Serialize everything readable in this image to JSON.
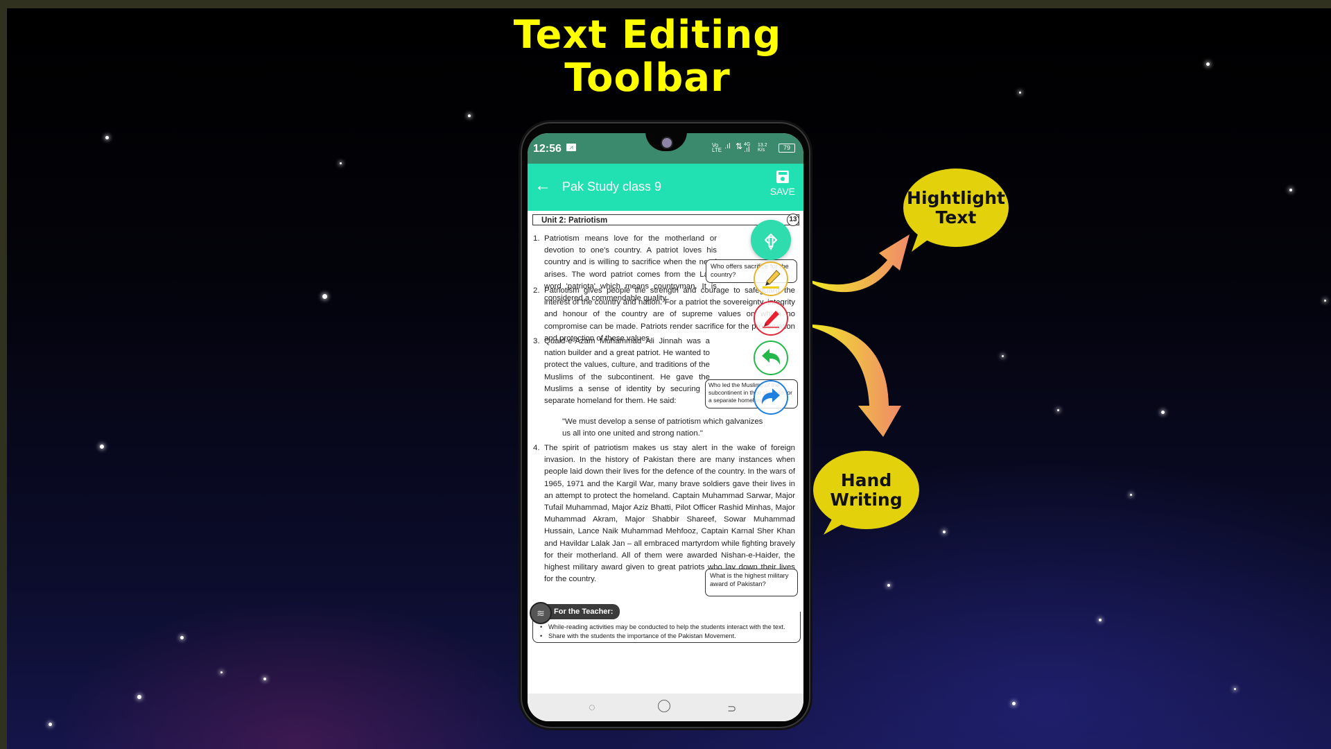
{
  "headline": {
    "line1": "Text Editing",
    "line2": "Toolbar"
  },
  "status_bar": {
    "time": "12:56",
    "activity_icon": "activity-icon",
    "volte": "Vo LTE",
    "network": "4G",
    "speed": "13.2",
    "speed_unit": "K/s",
    "battery": "79"
  },
  "app_bar": {
    "back_icon": "arrow-left-icon",
    "title": "Pak Study class 9",
    "save_label": "SAVE",
    "save_icon": "floppy-disk-icon"
  },
  "document": {
    "unit_title": "Unit 2:  Patriotism",
    "page_number": "13",
    "paragraphs": [
      {
        "num": "1.",
        "text": "Patriotism means love for the motherland or devotion to one's country. A patriot loves his country and is willing to sacrifice when the need arises. The word patriot comes from the Latin word 'patriota' which means countryman. It is considered a commendable quality."
      },
      {
        "num": "2.",
        "text": "Patriotism gives people the strength and courage to safeguard the interest of the country and nation. For a patriot the sovereignty, integrity and honour of the country are of supreme values on which no compromise can be made. Patriots render sacrifice for the preservation and protection of these values."
      },
      {
        "num": "3.",
        "text": "Quaid-e-Azam Muhammad Ali Jinnah was a nation builder and a great patriot. He wanted to protect the values, culture, and traditions of the Muslims of the subcontinent. He gave the Muslims a sense of identity by securing a separate homeland for them. He said:"
      },
      {
        "num": "4.",
        "text": "The spirit of patriotism makes us stay alert in the wake of foreign invasion. In the history of Pakistan there are many instances when people laid down their lives for the defence of the country. In the wars of 1965, 1971 and the Kargil War, many brave soldiers gave their lives in an attempt to protect the homeland. Captain Muhammad Sarwar, Major Tufail Muhammad, Major Aziz Bhatti, Pilot Officer Rashid Minhas, Major Muhammad Akram, Major Shabbir Shareef, Sowar Muhammad Hussain, Lance Naik Muhammad Mehfooz, Captain Karnal Sher Khan and Havildar Lalak Jan – all embraced martyrdom while fighting bravely for their motherland. All of them were awarded Nishan-e-Haider, the highest military award given to great patriots who lay down their lives for the country."
      }
    ],
    "quote": "\"We must develop a sense of patriotism which galvanizes us all into one united and strong nation.\"",
    "question_boxes": [
      "Who offers sacrifice for the country?",
      "Who led the Muslims of the subcontinent in their struggle for a separate homeland?",
      "What is the highest military award of Pakistan?"
    ],
    "teacher_title": "For the Teacher:",
    "teacher_notes": [
      "While-reading activities may be conducted to help the students interact with the text.",
      "Share with the students the importance of the Pakistan Movement."
    ]
  },
  "toolbar": [
    {
      "name": "toggle-toolbar",
      "icon": "pencil-diamond-icon",
      "color": "#2fdcae"
    },
    {
      "name": "highlighter",
      "icon": "highlighter-icon",
      "color": "#e8b430"
    },
    {
      "name": "pen",
      "icon": "pen-icon",
      "color": "#e0283a"
    },
    {
      "name": "undo",
      "icon": "undo-icon",
      "color": "#22b84a"
    },
    {
      "name": "redo",
      "icon": "redo-icon",
      "color": "#1e7fe0"
    }
  ],
  "nav_bar": {
    "recents": "recents-icon",
    "home": "home-icon",
    "back": "back-icon"
  },
  "callouts": {
    "highlight": {
      "line1": "Hightlight",
      "line2": "Text"
    },
    "handwriting": {
      "line1": "Hand",
      "line2": "Writing"
    }
  },
  "colors": {
    "headline": "#ffff00",
    "app_bar": "#21e0b2",
    "status_bar": "#3c8a6e",
    "callout": "#e3d20b",
    "frame": "#30311f"
  }
}
